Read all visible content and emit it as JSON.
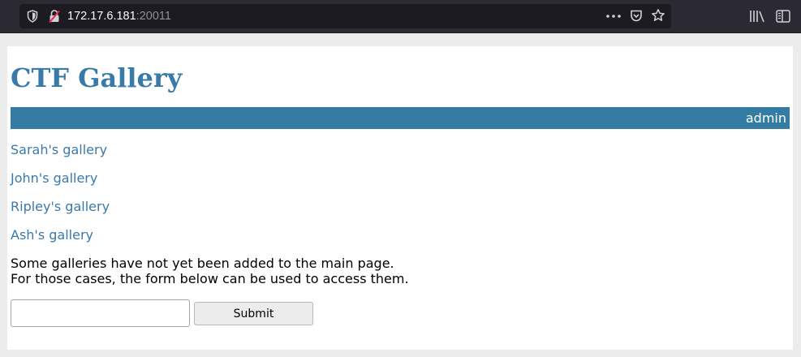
{
  "browser": {
    "url_host": "172.17.6.181",
    "url_port": ":20011",
    "icons": [
      "shield-icon",
      "insecure-lock-icon",
      "more-icon",
      "pocket-icon",
      "bookmark-star-icon",
      "library-icon",
      "sidebar-icon"
    ]
  },
  "header": {
    "title": "CTF Gallery",
    "username": "admin"
  },
  "galleries": [
    {
      "label": "Sarah's gallery"
    },
    {
      "label": "John's gallery"
    },
    {
      "label": "Ripley's gallery"
    },
    {
      "label": "Ash's gallery"
    }
  ],
  "notice": {
    "line1": "Some galleries have not yet been added to the main page.",
    "line2": "For those cases, the form below can be used to access them."
  },
  "form": {
    "input_value": "",
    "submit_label": "Submit"
  },
  "colors": {
    "accent": "#357ca5",
    "link": "#3a7aa8",
    "toolbar": "#2b2a33",
    "urlbar": "#1c1b22"
  }
}
